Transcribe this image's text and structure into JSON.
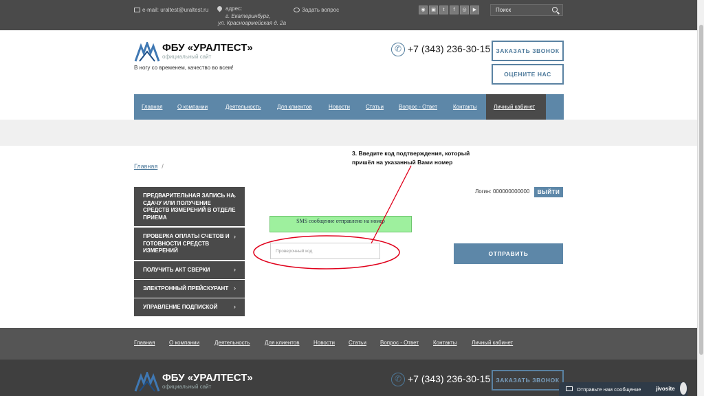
{
  "topbar": {
    "email": "e-mail: uraltest@uraltest.ru",
    "address_label": "адрес:",
    "address_city": "г. Екатеринбург,",
    "address_street": "ул. Красноармейская д. 2а",
    "ask_question": "Задать вопрос",
    "social": [
      "rss",
      "vk",
      "twitter",
      "f",
      "instagram",
      "youtube"
    ],
    "search_placeholder": "Поиск"
  },
  "header": {
    "logo_name": "ФБУ «УРАЛТЕСТ»",
    "logo_sub": "официальный сайт",
    "slogan": "В ногу со временем, качество во всем!",
    "phone": "+7 (343) 236-30-15",
    "callback_button": "ЗАКАЗАТЬ ЗВОНОК",
    "rate_button": "ОЦЕНИТЕ НАС"
  },
  "nav": {
    "items": [
      "Главная",
      "О компании",
      "Деятельность",
      "Для клиентов",
      "Новости",
      "Статьи",
      "Вопрос - Ответ",
      "Контакты",
      "Личный кабинет"
    ]
  },
  "breadcrumb": {
    "home": "Главная",
    "sep": "/"
  },
  "annotation": {
    "line1": "3. Введите код подтверждения, который",
    "line2": "пришёл на указанный Вами номер"
  },
  "sidebar": {
    "items": [
      "ПРЕДВАРИТЕЛЬНАЯ ЗАПИСЬ НА СДАЧУ ИЛИ ПОЛУЧЕНИЕ СРЕДСТВ ИЗМЕРЕНИЙ В ОТДЕЛЕ ПРИЕМА",
      "ПРОВЕРКА ОПЛАТЫ СЧЕТОВ И ГОТОВНОСТИ СРЕДСТВ ИЗМЕРЕНИЙ",
      "ПОЛУЧИТЬ АКТ СВЕРКИ",
      "ЭЛЕКТРОННЫЙ ПРЕЙСКУРАНТ",
      "УПРАВЛЕНИЕ ПОДПИСКОЙ"
    ],
    "chevron": "›"
  },
  "cabinet": {
    "login_text": "Логин: 000000000000",
    "logout_button": "ВЫЙТИ",
    "sms_notice": "SMS сообщение отправлено на номер",
    "code_placeholder": "Проверочный код",
    "code_value": "",
    "send_button": "ОТПРАВИТЬ"
  },
  "footer": {
    "items": [
      "Главная",
      "О компании",
      "Деятельность",
      "Для клиентов",
      "Новости",
      "Статьи",
      "Вопрос - Ответ",
      "Контакты",
      "Личный кабинет"
    ],
    "logo_name": "ФБУ «УРАЛТЕСТ»",
    "logo_sub": "официальный сайт",
    "phone": "+7 (343) 236-30-15",
    "callback_button": "ЗАКАЗАТЬ ЗВОНОК"
  },
  "jivo": {
    "message": "Отправьте нам сообщение",
    "brand": "jivosite"
  },
  "colors": {
    "accent": "#5d87a8",
    "dark": "#4a4a4a",
    "sms_bg": "#9ef09e",
    "annotation": "#e0001b"
  }
}
